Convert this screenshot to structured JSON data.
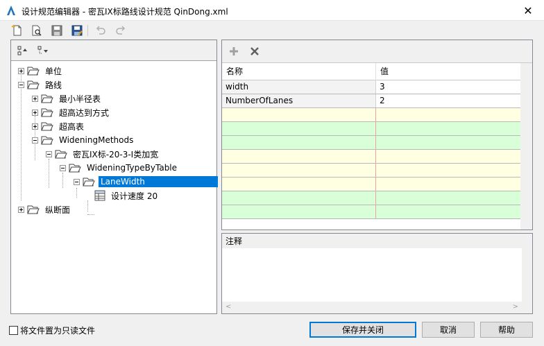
{
  "window": {
    "title": "设计规范编辑器 - 密瓦IX标路线设计规范 QinDong.xml",
    "close_glyph": "✕"
  },
  "toolbar": {
    "items": [
      {
        "name": "new-file-icon"
      },
      {
        "name": "open-file-icon"
      },
      {
        "name": "save-icon"
      },
      {
        "name": "save-as-icon"
      },
      {
        "name": "undo-icon"
      },
      {
        "name": "redo-icon"
      }
    ]
  },
  "tree": {
    "nodes": [
      {
        "label": "单位",
        "state": "collapsed"
      },
      {
        "label": "路线",
        "state": "expanded"
      },
      {
        "label": "最小半径表",
        "state": "collapsed"
      },
      {
        "label": "超高达到方式",
        "state": "collapsed"
      },
      {
        "label": "超高表",
        "state": "collapsed"
      },
      {
        "label": "WideningMethods",
        "state": "expanded"
      },
      {
        "label": "密瓦IX标-20-3-I类加宽",
        "state": "expanded"
      },
      {
        "label": "WideningTypeByTable",
        "state": "expanded"
      },
      {
        "label": "LaneWidth",
        "state": "expanded",
        "selected": true
      },
      {
        "label": "设计速度 20",
        "state": "leaf"
      },
      {
        "label": "纵断面",
        "state": "collapsed"
      }
    ]
  },
  "grid": {
    "columns": [
      "名称",
      "值"
    ],
    "rows": [
      {
        "name": "width",
        "value": "3"
      },
      {
        "name": "NumberOfLanes",
        "value": "2"
      }
    ]
  },
  "notes": {
    "label": "注释",
    "value": ""
  },
  "footer": {
    "readonly_label": "将文件置为只读文件",
    "readonly_checked": false,
    "save_close_label": "保存并关闭",
    "cancel_label": "取消",
    "help_label": "帮助"
  },
  "colors": {
    "accent": "#0078d7",
    "grid_yellow": "#ffffe1",
    "grid_green": "#d8ffd8"
  }
}
